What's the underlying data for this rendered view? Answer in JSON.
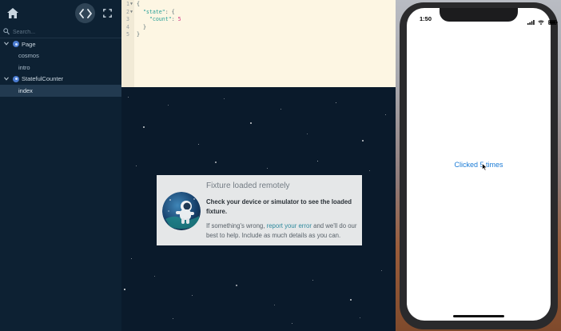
{
  "sidebar": {
    "search_placeholder": "Search...",
    "tree": [
      {
        "label": "Page",
        "type": "component",
        "expanded": true
      },
      {
        "label": "cosmos",
        "type": "fixture"
      },
      {
        "label": "intro",
        "type": "fixture"
      },
      {
        "label": "StatefulCounter",
        "type": "component",
        "expanded": true
      },
      {
        "label": "index",
        "type": "fixture",
        "selected": true
      }
    ]
  },
  "editor": {
    "lines": [
      {
        "num": "1",
        "fold": "▼",
        "text": "{"
      },
      {
        "num": "2",
        "fold": "▼",
        "indent": "  ",
        "key": "\"state\"",
        "rest": ": {"
      },
      {
        "num": "3",
        "fold": "",
        "indent": "    ",
        "key": "\"count\"",
        "rest": ": ",
        "value": "5"
      },
      {
        "num": "4",
        "fold": "",
        "text": "  }"
      },
      {
        "num": "5",
        "fold": "",
        "text": "}"
      }
    ]
  },
  "notice": {
    "title": "Fixture loaded remotely",
    "heading": "Check your device or simulator to see the loaded fixture.",
    "body_pre": "If something's wrong, ",
    "link": "report your error",
    "body_post": " and we'll do our best to help. Include as much details as you can."
  },
  "phone": {
    "time": "1:50",
    "counter_text": "Clicked 5 times"
  },
  "colors": {
    "sidebar_bg": "#0d2133",
    "editor_bg": "#fdf6e3",
    "stage_bg": "#0a1a2b",
    "link": "#1a7bd6"
  },
  "icons": [
    "home-icon",
    "code-icon",
    "fullscreen-icon",
    "search-icon",
    "chevron-down-icon",
    "component-icon",
    "astronaut-icon",
    "wifi-icon",
    "battery-icon",
    "cursor-icon"
  ]
}
